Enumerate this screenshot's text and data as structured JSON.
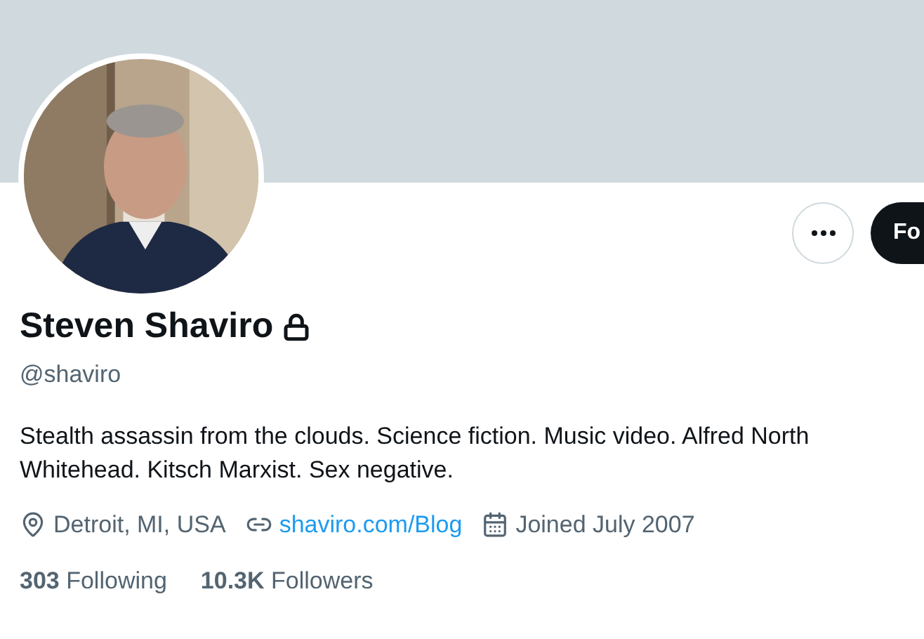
{
  "profile": {
    "name": "Steven Shaviro",
    "protected": true,
    "handle": "@shaviro",
    "bio": "Stealth assassin from the clouds. Science fiction. Music video. Alfred North Whitehead. Kitsch Marxist. Sex negative.",
    "location": "Detroit, MI, USA",
    "website": "shaviro.com/Blog",
    "joined": "Joined July 2007",
    "stats": [
      {
        "text": "**303** Following"
      },
      {
        "text": "**10.3K** Followers"
      }
    ]
  },
  "actions": {
    "follow_button": "Fo"
  }
}
